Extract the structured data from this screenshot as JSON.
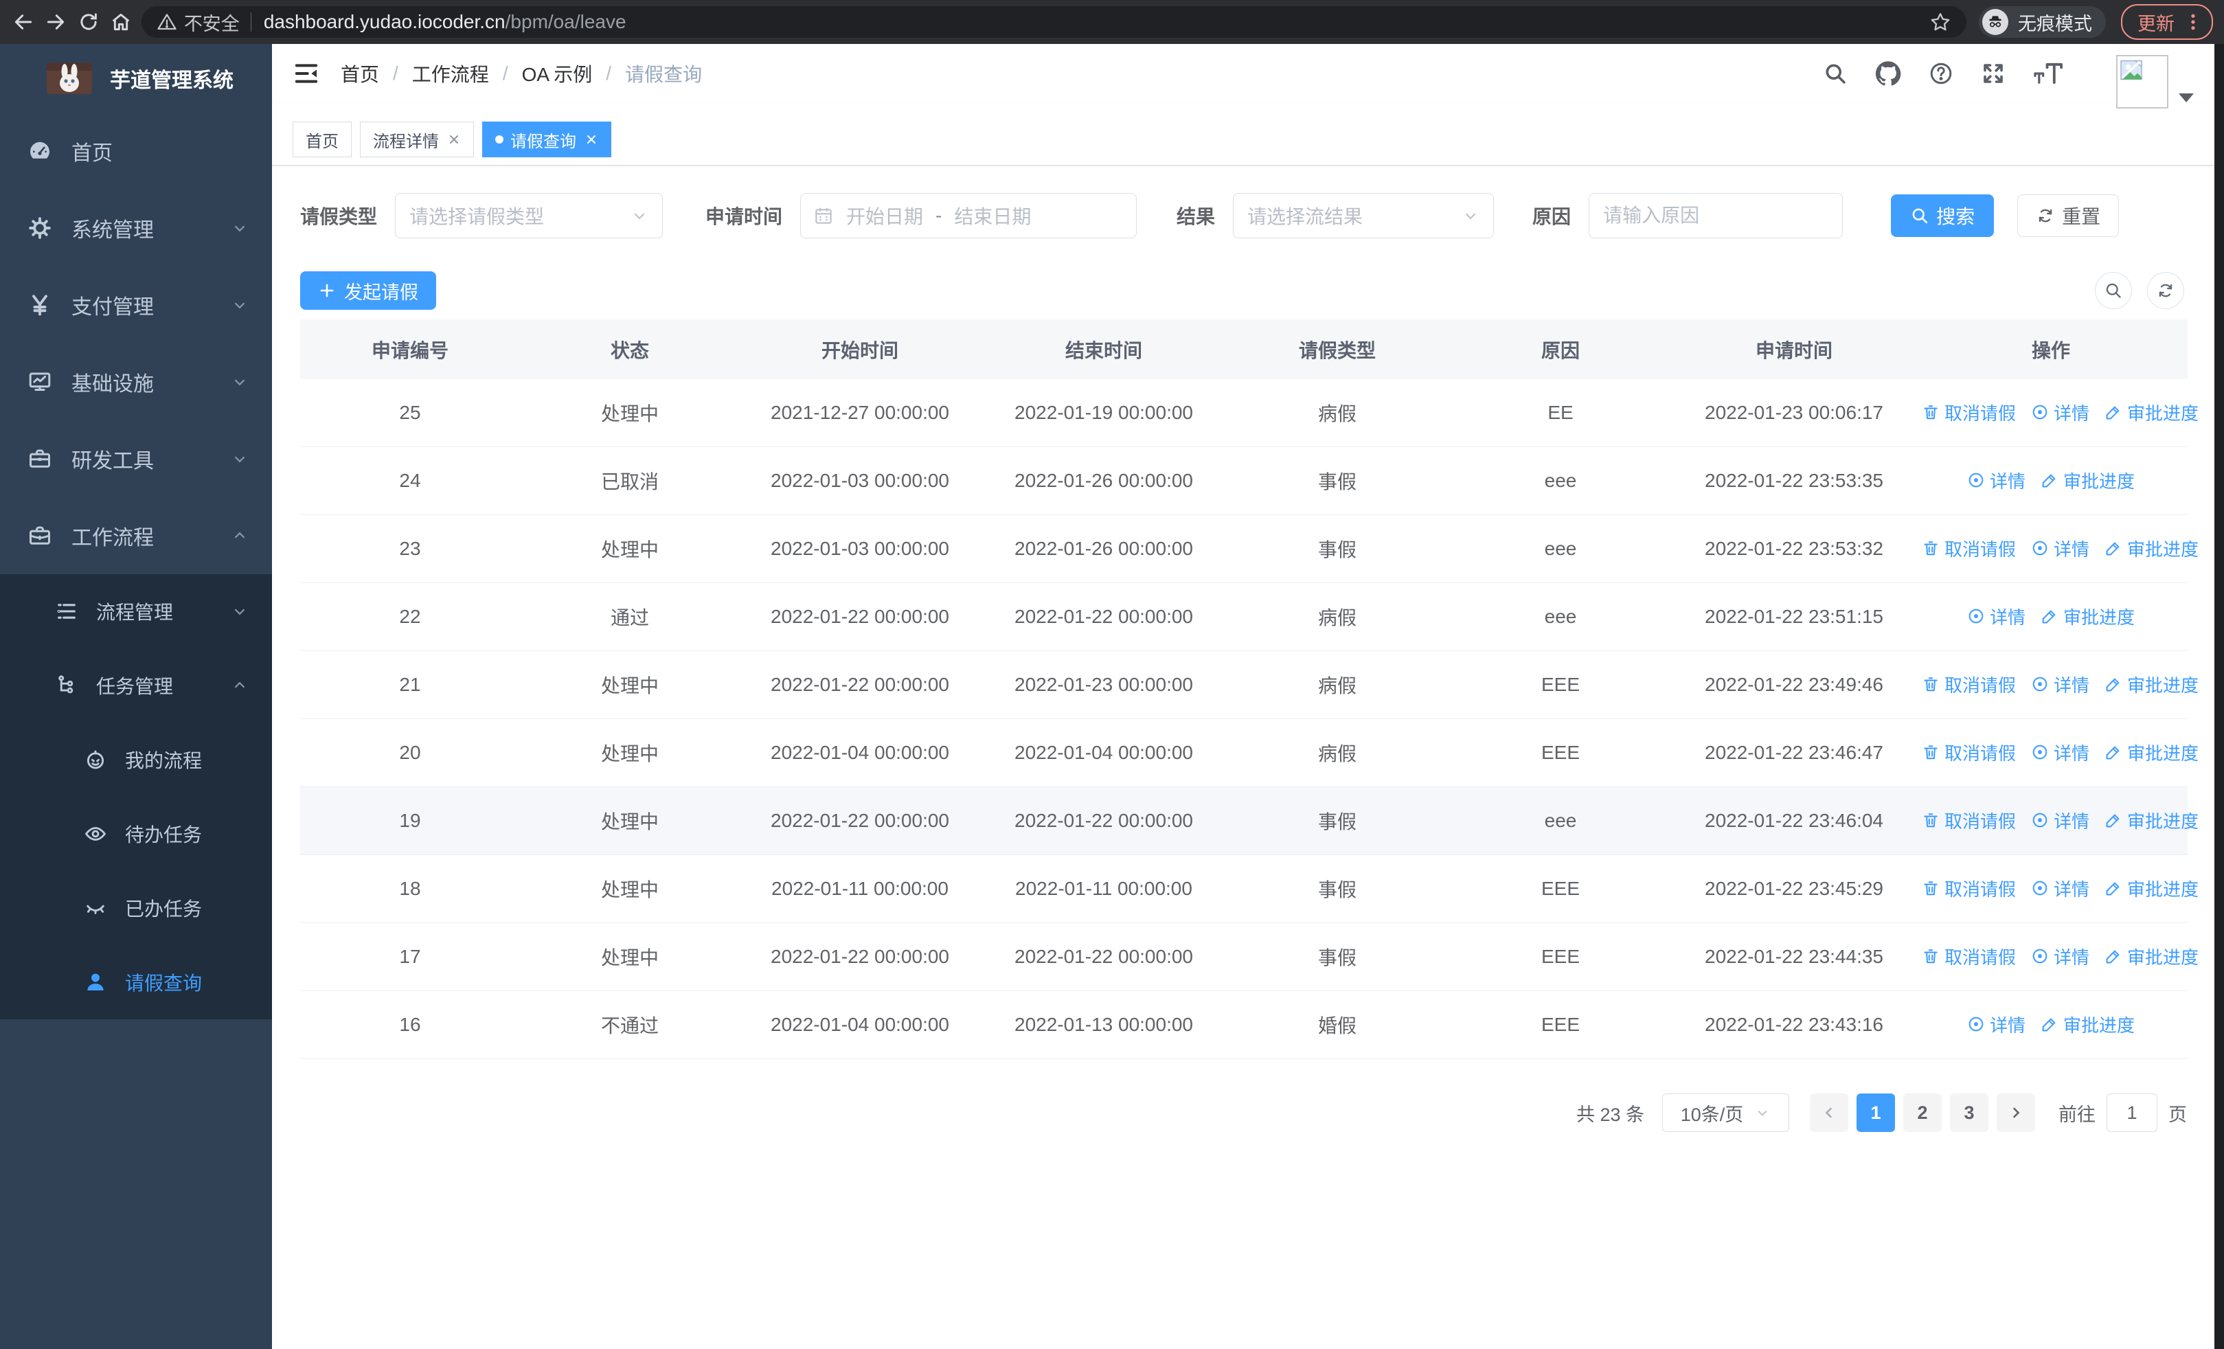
{
  "browser": {
    "security_warning": "不安全",
    "url_host": "dashboard.yudao.iocoder.cn",
    "url_path": "/bpm/oa/leave",
    "incognito_label": "无痕模式",
    "update_button": "更新"
  },
  "sidebar": {
    "logo_title": "芋道管理系统",
    "items": [
      {
        "label": "首页",
        "icon": "dashboard-icon"
      },
      {
        "label": "系统管理",
        "icon": "gear-icon",
        "arrow": "down"
      },
      {
        "label": "支付管理",
        "icon": "yen-icon",
        "arrow": "down"
      },
      {
        "label": "基础设施",
        "icon": "monitor-icon",
        "arrow": "down"
      },
      {
        "label": "研发工具",
        "icon": "toolbox-icon",
        "arrow": "down"
      },
      {
        "label": "工作流程",
        "icon": "briefcase-icon",
        "arrow": "up",
        "expanded": true
      }
    ],
    "submenu": [
      {
        "label": "流程管理",
        "icon": "list-icon",
        "arrow": "down"
      },
      {
        "label": "任务管理",
        "icon": "tree-icon",
        "arrow": "up",
        "expanded": true
      }
    ],
    "tasks": [
      {
        "label": "我的流程",
        "icon": "robot-icon"
      },
      {
        "label": "待办任务",
        "icon": "eye-open-icon"
      },
      {
        "label": "已办任务",
        "icon": "eye-closed-icon"
      },
      {
        "label": "请假查询",
        "icon": "user-icon",
        "active": true
      }
    ]
  },
  "header": {
    "breadcrumb": [
      "首页",
      "工作流程",
      "OA 示例",
      "请假查询"
    ],
    "icons": [
      "search",
      "github",
      "help",
      "fullscreen",
      "font-size",
      "avatar"
    ]
  },
  "tabs": [
    {
      "label": "首页",
      "closable": false,
      "active": false
    },
    {
      "label": "流程详情",
      "closable": true,
      "active": false
    },
    {
      "label": "请假查询",
      "closable": true,
      "active": true
    }
  ],
  "filters": {
    "leave_type_label": "请假类型",
    "leave_type_placeholder": "请选择请假类型",
    "apply_time_label": "申请时间",
    "start_date_placeholder": "开始日期",
    "date_separator": "-",
    "end_date_placeholder": "结束日期",
    "result_label": "结果",
    "result_placeholder": "请选择流结果",
    "reason_label": "原因",
    "reason_placeholder": "请输入原因",
    "search_button": "搜索",
    "reset_button": "重置"
  },
  "toolbar": {
    "create_button": "发起请假"
  },
  "table": {
    "columns": [
      "申请编号",
      "状态",
      "开始时间",
      "结束时间",
      "请假类型",
      "原因",
      "申请时间",
      "操作"
    ],
    "action_labels": {
      "cancel": "取消请假",
      "detail": "详情",
      "progress": "审批进度"
    },
    "rows": [
      {
        "id": "25",
        "status": "处理中",
        "start": "2021-12-27 00:00:00",
        "end": "2022-01-19 00:00:00",
        "type": "病假",
        "reason": "EE",
        "applied": "2022-01-23 00:06:17",
        "actions": [
          "cancel",
          "detail",
          "progress"
        ]
      },
      {
        "id": "24",
        "status": "已取消",
        "start": "2022-01-03 00:00:00",
        "end": "2022-01-26 00:00:00",
        "type": "事假",
        "reason": "eee",
        "applied": "2022-01-22 23:53:35",
        "actions": [
          "detail",
          "progress"
        ]
      },
      {
        "id": "23",
        "status": "处理中",
        "start": "2022-01-03 00:00:00",
        "end": "2022-01-26 00:00:00",
        "type": "事假",
        "reason": "eee",
        "applied": "2022-01-22 23:53:32",
        "actions": [
          "cancel",
          "detail",
          "progress"
        ]
      },
      {
        "id": "22",
        "status": "通过",
        "start": "2022-01-22 00:00:00",
        "end": "2022-01-22 00:00:00",
        "type": "病假",
        "reason": "eee",
        "applied": "2022-01-22 23:51:15",
        "actions": [
          "detail",
          "progress"
        ]
      },
      {
        "id": "21",
        "status": "处理中",
        "start": "2022-01-22 00:00:00",
        "end": "2022-01-23 00:00:00",
        "type": "病假",
        "reason": "EEE",
        "applied": "2022-01-22 23:49:46",
        "actions": [
          "cancel",
          "detail",
          "progress"
        ]
      },
      {
        "id": "20",
        "status": "处理中",
        "start": "2022-01-04 00:00:00",
        "end": "2022-01-04 00:00:00",
        "type": "病假",
        "reason": "EEE",
        "applied": "2022-01-22 23:46:47",
        "actions": [
          "cancel",
          "detail",
          "progress"
        ]
      },
      {
        "id": "19",
        "status": "处理中",
        "start": "2022-01-22 00:00:00",
        "end": "2022-01-22 00:00:00",
        "type": "事假",
        "reason": "eee",
        "applied": "2022-01-22 23:46:04",
        "actions": [
          "cancel",
          "detail",
          "progress"
        ],
        "highlight": true
      },
      {
        "id": "18",
        "status": "处理中",
        "start": "2022-01-11 00:00:00",
        "end": "2022-01-11 00:00:00",
        "type": "事假",
        "reason": "EEE",
        "applied": "2022-01-22 23:45:29",
        "actions": [
          "cancel",
          "detail",
          "progress"
        ]
      },
      {
        "id": "17",
        "status": "处理中",
        "start": "2022-01-22 00:00:00",
        "end": "2022-01-22 00:00:00",
        "type": "事假",
        "reason": "EEE",
        "applied": "2022-01-22 23:44:35",
        "actions": [
          "cancel",
          "detail",
          "progress"
        ]
      },
      {
        "id": "16",
        "status": "不通过",
        "start": "2022-01-04 00:00:00",
        "end": "2022-01-13 00:00:00",
        "type": "婚假",
        "reason": "EEE",
        "applied": "2022-01-22 23:43:16",
        "actions": [
          "detail",
          "progress"
        ]
      }
    ]
  },
  "pagination": {
    "total_text": "共 23 条",
    "page_size": "10条/页",
    "pages": [
      "1",
      "2",
      "3"
    ],
    "active_page": "1",
    "goto_label": "前往",
    "goto_value": "1",
    "page_suffix": "页"
  },
  "colors": {
    "primary": "#409eff",
    "sidebar_bg": "#304156",
    "sidebar_submenu_bg": "#1f2d3d",
    "table_header_bg": "#f6f7f9",
    "row_highlight": "#f5f7fa",
    "update_button": "#ef8e86"
  }
}
